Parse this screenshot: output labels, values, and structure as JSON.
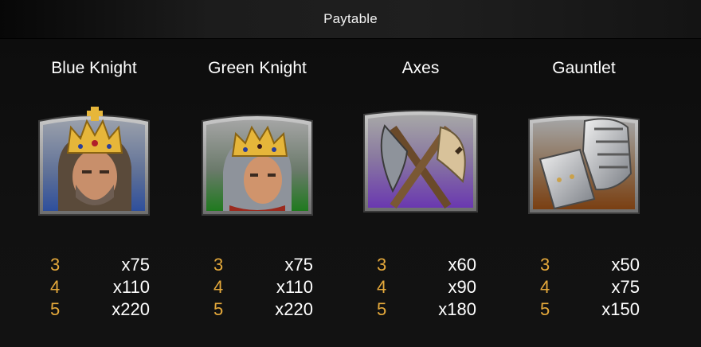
{
  "header": {
    "title": "Paytable"
  },
  "symbols": [
    {
      "name": "Blue Knight",
      "icon": "blue-knight-icon",
      "pays": [
        {
          "count": "3",
          "multiplier": "x75"
        },
        {
          "count": "4",
          "multiplier": "x110"
        },
        {
          "count": "5",
          "multiplier": "x220"
        }
      ]
    },
    {
      "name": "Green Knight",
      "icon": "green-knight-icon",
      "pays": [
        {
          "count": "3",
          "multiplier": "x75"
        },
        {
          "count": "4",
          "multiplier": "x110"
        },
        {
          "count": "5",
          "multiplier": "x220"
        }
      ]
    },
    {
      "name": "Axes",
      "icon": "axes-icon",
      "pays": [
        {
          "count": "3",
          "multiplier": "x60"
        },
        {
          "count": "4",
          "multiplier": "x90"
        },
        {
          "count": "5",
          "multiplier": "x180"
        }
      ]
    },
    {
      "name": "Gauntlet",
      "icon": "gauntlet-icon",
      "pays": [
        {
          "count": "3",
          "multiplier": "x50"
        },
        {
          "count": "4",
          "multiplier": "x75"
        },
        {
          "count": "5",
          "multiplier": "x150"
        }
      ]
    }
  ],
  "colors": {
    "count_text": "#e5a93b",
    "multiplier_text": "#ffffff",
    "background": "#0a0a0a",
    "blue_knight_bg": "#3b5fa8",
    "green_knight_bg": "#2f7d2a",
    "axes_bg": "#6a3fa3",
    "gauntlet_bg": "#7a4a1f"
  }
}
